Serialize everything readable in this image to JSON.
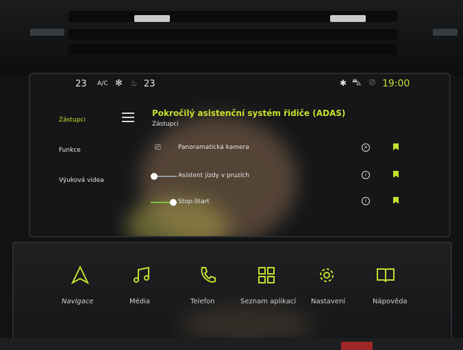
{
  "status_bar": {
    "temp_left": "23",
    "ac": "A/C",
    "temp_right": "23",
    "time": "19:00",
    "icons": [
      "fan-icon",
      "seat-heat-icon",
      "bluetooth-icon",
      "car-icon",
      "notification-icon"
    ]
  },
  "sidebar": {
    "items": [
      {
        "label": "Zástupci",
        "active": true
      },
      {
        "label": "Funkce",
        "active": false
      },
      {
        "label": "Výuková videa",
        "active": false
      }
    ]
  },
  "main": {
    "title": "Pokročilý asistenční systém řidiče (ADAS)",
    "subtitle": "Zástupci",
    "rows": [
      {
        "label": "Panoramatická kamera",
        "icon": "camera-icon"
      },
      {
        "label": "Asistent jízdy v pruzích",
        "icon": "toggle-off"
      },
      {
        "label": "Stop-Start",
        "icon": "toggle-on"
      }
    ]
  },
  "bottom_bar": {
    "items": [
      {
        "label": "Navigace",
        "icon": "navigation-icon"
      },
      {
        "label": "Média",
        "icon": "music-icon"
      },
      {
        "label": "Telefon",
        "icon": "phone-icon"
      },
      {
        "label": "Seznam aplikací",
        "icon": "apps-icon"
      },
      {
        "label": "Nastavení",
        "icon": "gear-icon"
      },
      {
        "label": "Nápověda",
        "icon": "book-icon"
      }
    ]
  },
  "colors": {
    "accent": "#c8e02e",
    "toggle_on": "#7fc43a"
  }
}
